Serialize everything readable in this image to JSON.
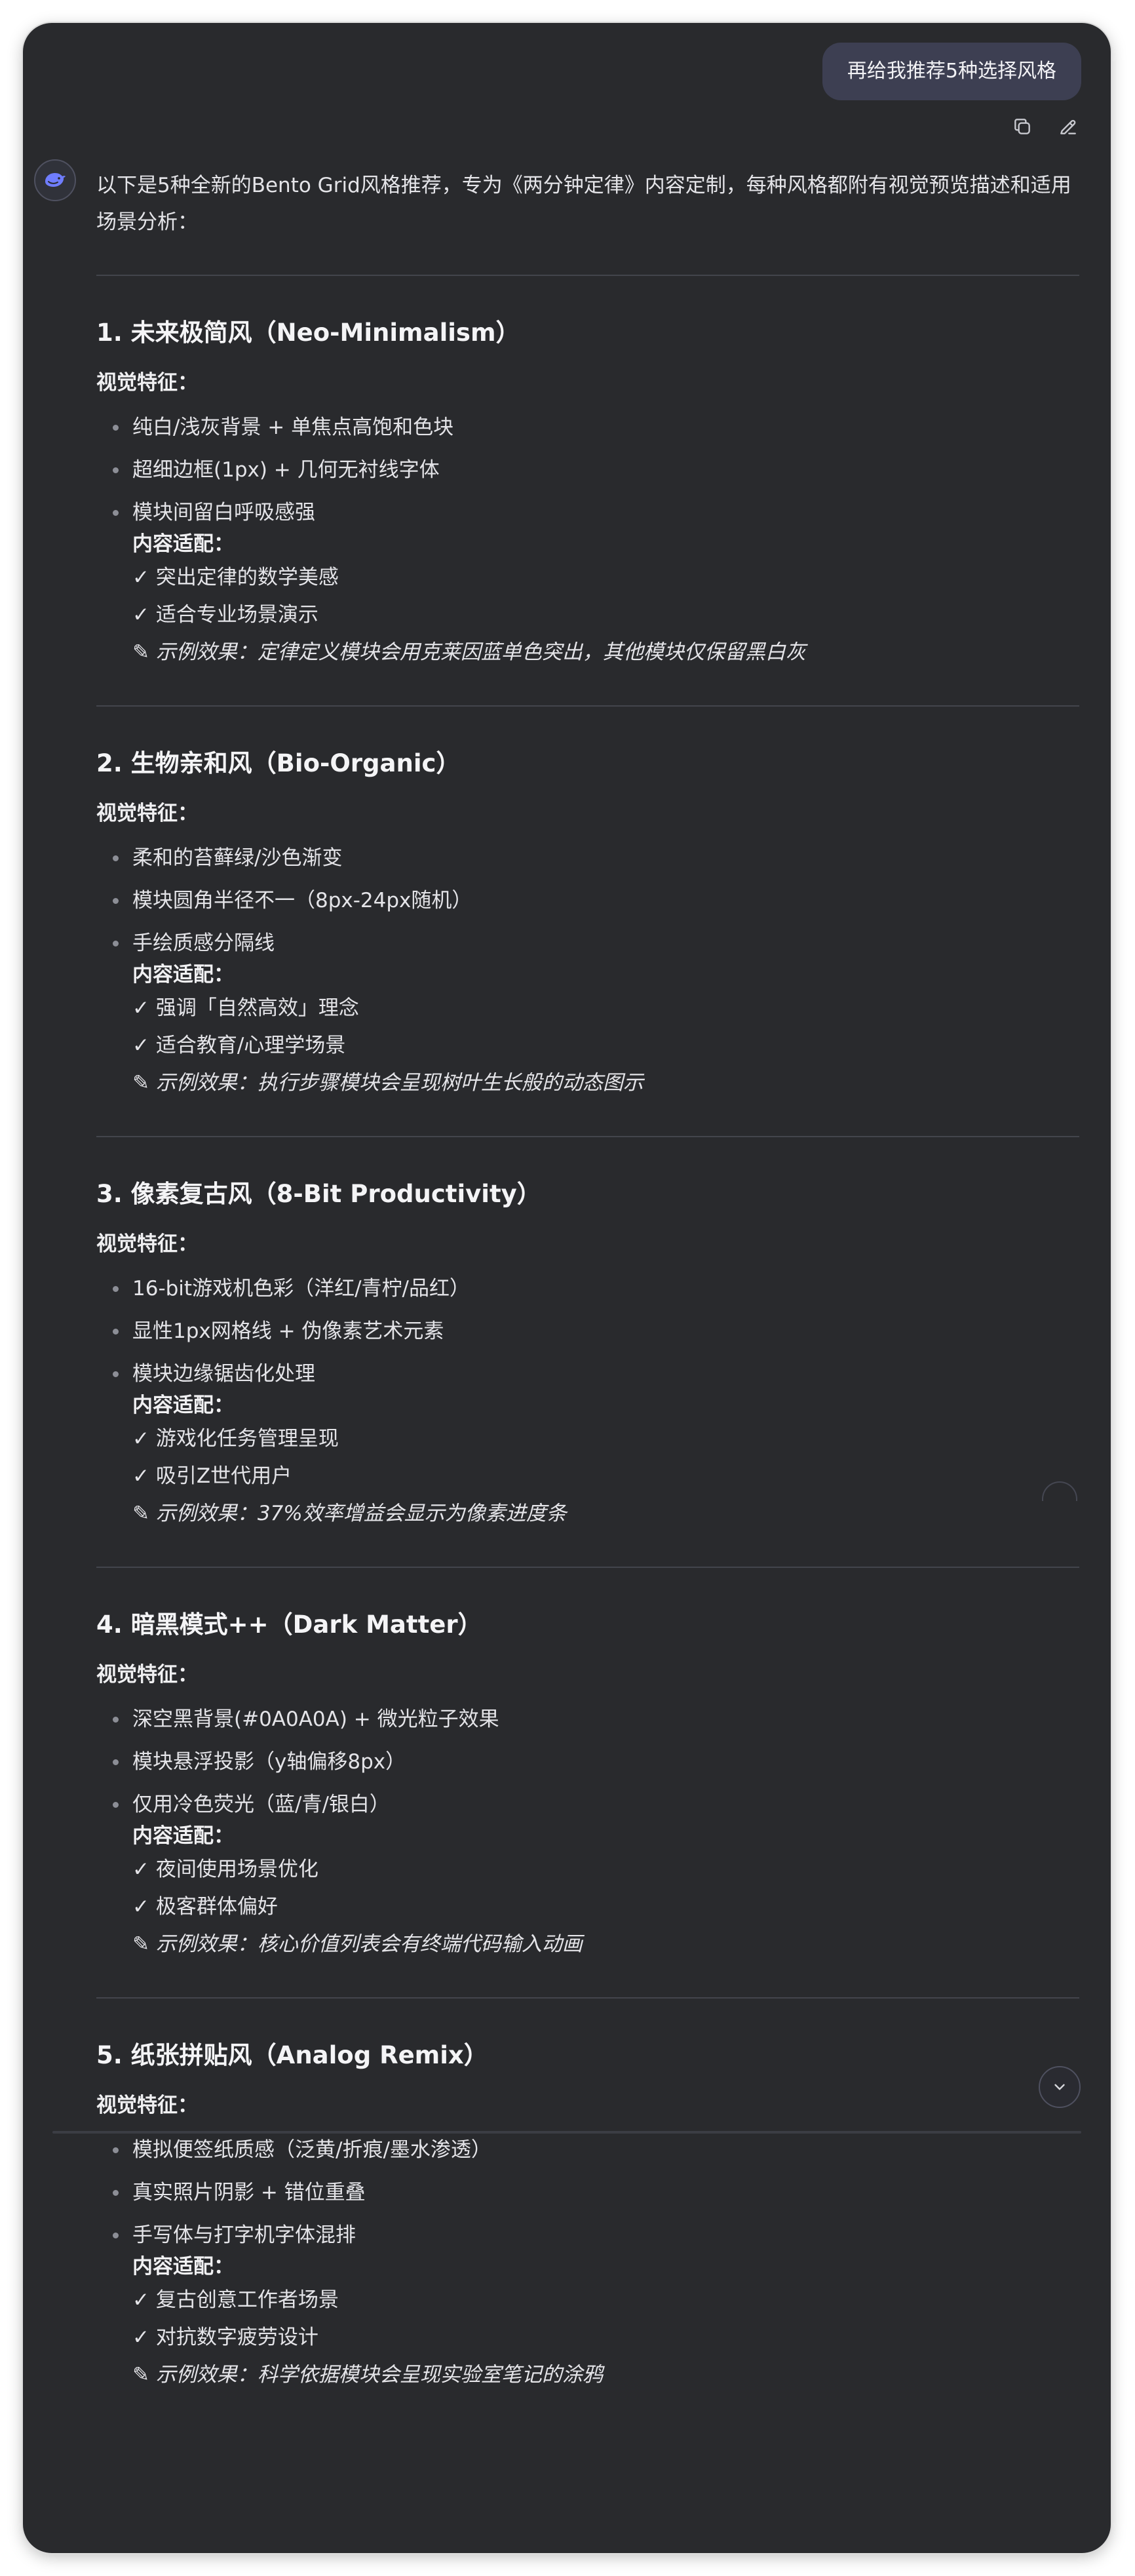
{
  "user_message": "再给我推荐5种选择风格",
  "actions": {
    "copy_icon": "copy-icon",
    "edit_icon": "edit-icon"
  },
  "intro": "以下是5种全新的Bento Grid风格推荐，专为《两分钟定律》内容定制，每种风格都附有视觉预览描述和适用场景分析：",
  "visual_label": "视觉特征",
  "content_label": "内容适配",
  "label_colon": "：",
  "sections": [
    {
      "title": "1. 未来极简风（Neo-Minimalism）",
      "bullets": [
        "纯白/浅灰背景 + 单焦点高饱和色块",
        "超细边框(1px) + 几何无衬线字体",
        "模块间留白呼吸感强"
      ],
      "checks": [
        "✓ 突出定律的数学美感",
        "✓ 适合专业场景演示"
      ],
      "example": "✎ 示例效果：定律定义模块会用克莱因蓝单色突出，其他模块仅保留黑白灰"
    },
    {
      "title": "2. 生物亲和风（Bio-Organic）",
      "bullets": [
        "柔和的苔藓绿/沙色渐变",
        "模块圆角半径不一（8px-24px随机）",
        "手绘质感分隔线"
      ],
      "checks": [
        "✓ 强调「自然高效」理念",
        "✓ 适合教育/心理学场景"
      ],
      "example": "✎ 示例效果：执行步骤模块会呈现树叶生长般的动态图示"
    },
    {
      "title": "3. 像素复古风（8-Bit Productivity）",
      "bullets": [
        "16-bit游戏机色彩（洋红/青柠/品红）",
        "显性1px网格线 + 伪像素艺术元素",
        "模块边缘锯齿化处理"
      ],
      "checks": [
        "✓ 游戏化任务管理呈现",
        "✓ 吸引Z世代用户"
      ],
      "example": "✎ 示例效果：37%效率增益会显示为像素进度条"
    },
    {
      "title": "4. 暗黑模式++（Dark Matter）",
      "bullets": [
        "深空黑背景(#0A0A0A) + 微光粒子效果",
        "模块悬浮投影（y轴偏移8px）",
        "仅用冷色荧光（蓝/青/银白）"
      ],
      "checks": [
        "✓ 夜间使用场景优化",
        "✓ 极客群体偏好"
      ],
      "example": "✎ 示例效果：核心价值列表会有终端代码输入动画"
    },
    {
      "title": "5. 纸张拼贴风（Analog Remix）",
      "bullets": [
        "模拟便签纸质感（泛黄/折痕/墨水渗透）",
        "真实照片阴影 + 错位重叠",
        "手写体与打字机字体混排"
      ],
      "checks": [
        "✓ 复古创意工作者场景",
        "✓ 对抗数字疲劳设计"
      ],
      "example": "✎ 示例效果：科学依据模块会呈现实验室笔记的涂鸦"
    }
  ],
  "colors": {
    "background": "#292a2d",
    "bubble": "#3d3f52",
    "text": "#e4e4e8",
    "divider": "#43454c",
    "avatar_accent": "#6f7dff"
  },
  "scroll_icon": "chevron-down-icon"
}
